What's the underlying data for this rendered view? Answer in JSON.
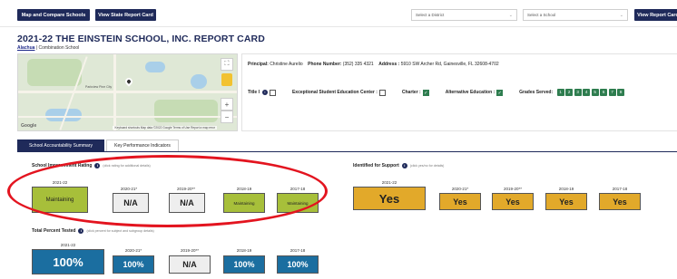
{
  "topbar": {
    "map_compare_label": "Map and Compare Schools",
    "state_report_label": "View State Report Card",
    "district_placeholder": "Select a District",
    "school_placeholder": "Select a School",
    "view_report_label": "View Report Card"
  },
  "header": {
    "title": "2021-22 THE EINSTEIN SCHOOL, INC. REPORT CARD",
    "district_link": "Alachua",
    "school_type": " | Combination School"
  },
  "map": {
    "google_label": "Google",
    "attribution": "Keyboard shortcuts   Map data ©2022 Google   Terms of Use   Report a map error",
    "town_label": "Parkview Pine\nCity",
    "zoom_in": "+",
    "zoom_out": "−",
    "fullscreen": "⛶"
  },
  "info": {
    "principal_label": "Principal:",
    "principal_value": "Christine Aurelio",
    "phone_label": "Phone Number:",
    "phone_value": "(352) 335 4321",
    "address_label": "Address :",
    "address_value": "5910 SW Archer Rd, Gainesville, FL 32608-4702",
    "title1_label": "Title I",
    "ese_label": "Exceptional Student Education Center :",
    "charter_label": "Charter :",
    "alt_ed_label": "Alternative Education :",
    "grades_label": "Grades Served:",
    "grades": [
      "1",
      "2",
      "3",
      "4",
      "5",
      "6",
      "7",
      "8"
    ]
  },
  "tabs": {
    "active": "School Accountability Summary",
    "inactive": "Key Performance Indicators"
  },
  "improvement": {
    "label": "School Improvement Rating",
    "note": "(click rating for additional details)",
    "years": [
      "2021-22",
      "2020-21*",
      "2019-20**",
      "2018-19",
      "2017-18"
    ],
    "values": [
      "Maintaining",
      "N/A",
      "N/A",
      "Maintaining",
      "Maintaining"
    ]
  },
  "support": {
    "label": "Identified for Support",
    "note": "(click yes/no for details)",
    "years": [
      "2021-22",
      "2020-21*",
      "2019-20**",
      "2018-19",
      "2017-18"
    ],
    "values": [
      "Yes",
      "Yes",
      "Yes",
      "Yes",
      "Yes"
    ]
  },
  "tested": {
    "label": "Total Percent Tested",
    "note": "(click percent for subject and subgroup details)",
    "years": [
      "2021-22",
      "2020-21*",
      "2019-20**",
      "2018-19",
      "2017-18"
    ],
    "values": [
      "100%",
      "100%",
      "N/A",
      "100%",
      "100%"
    ]
  },
  "colors": {
    "navy": "#1f2a5a",
    "maintaining_green": "#a7bf3a",
    "yes_gold": "#e2a92a",
    "percent_blue": "#1b6ea0",
    "highlight_red": "#e3141f",
    "check_green": "#2e7d4f"
  }
}
